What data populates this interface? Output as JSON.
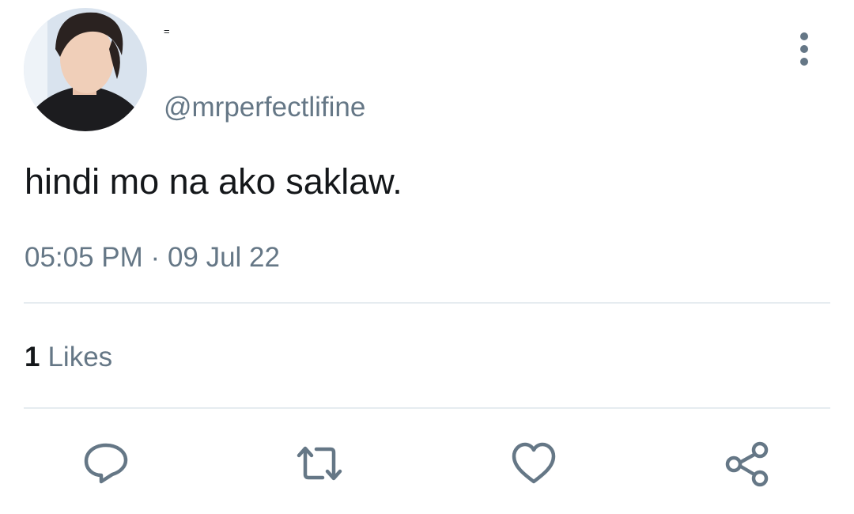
{
  "tweet": {
    "display_name": "=",
    "handle": "@mrperfectlifine",
    "text": "hindi mo na ako saklaw.",
    "time": "05:05 PM",
    "separator": "·",
    "date": "09 Jul 22",
    "likes_count": "1",
    "likes_label": "Likes"
  },
  "icons": {
    "more": "more-vertical-icon",
    "reply": "reply-icon",
    "retweet": "retweet-icon",
    "like": "heart-icon",
    "share": "share-icon"
  },
  "colors": {
    "text": "#14171a",
    "secondary": "#657786",
    "divider": "#e6ecf0"
  }
}
